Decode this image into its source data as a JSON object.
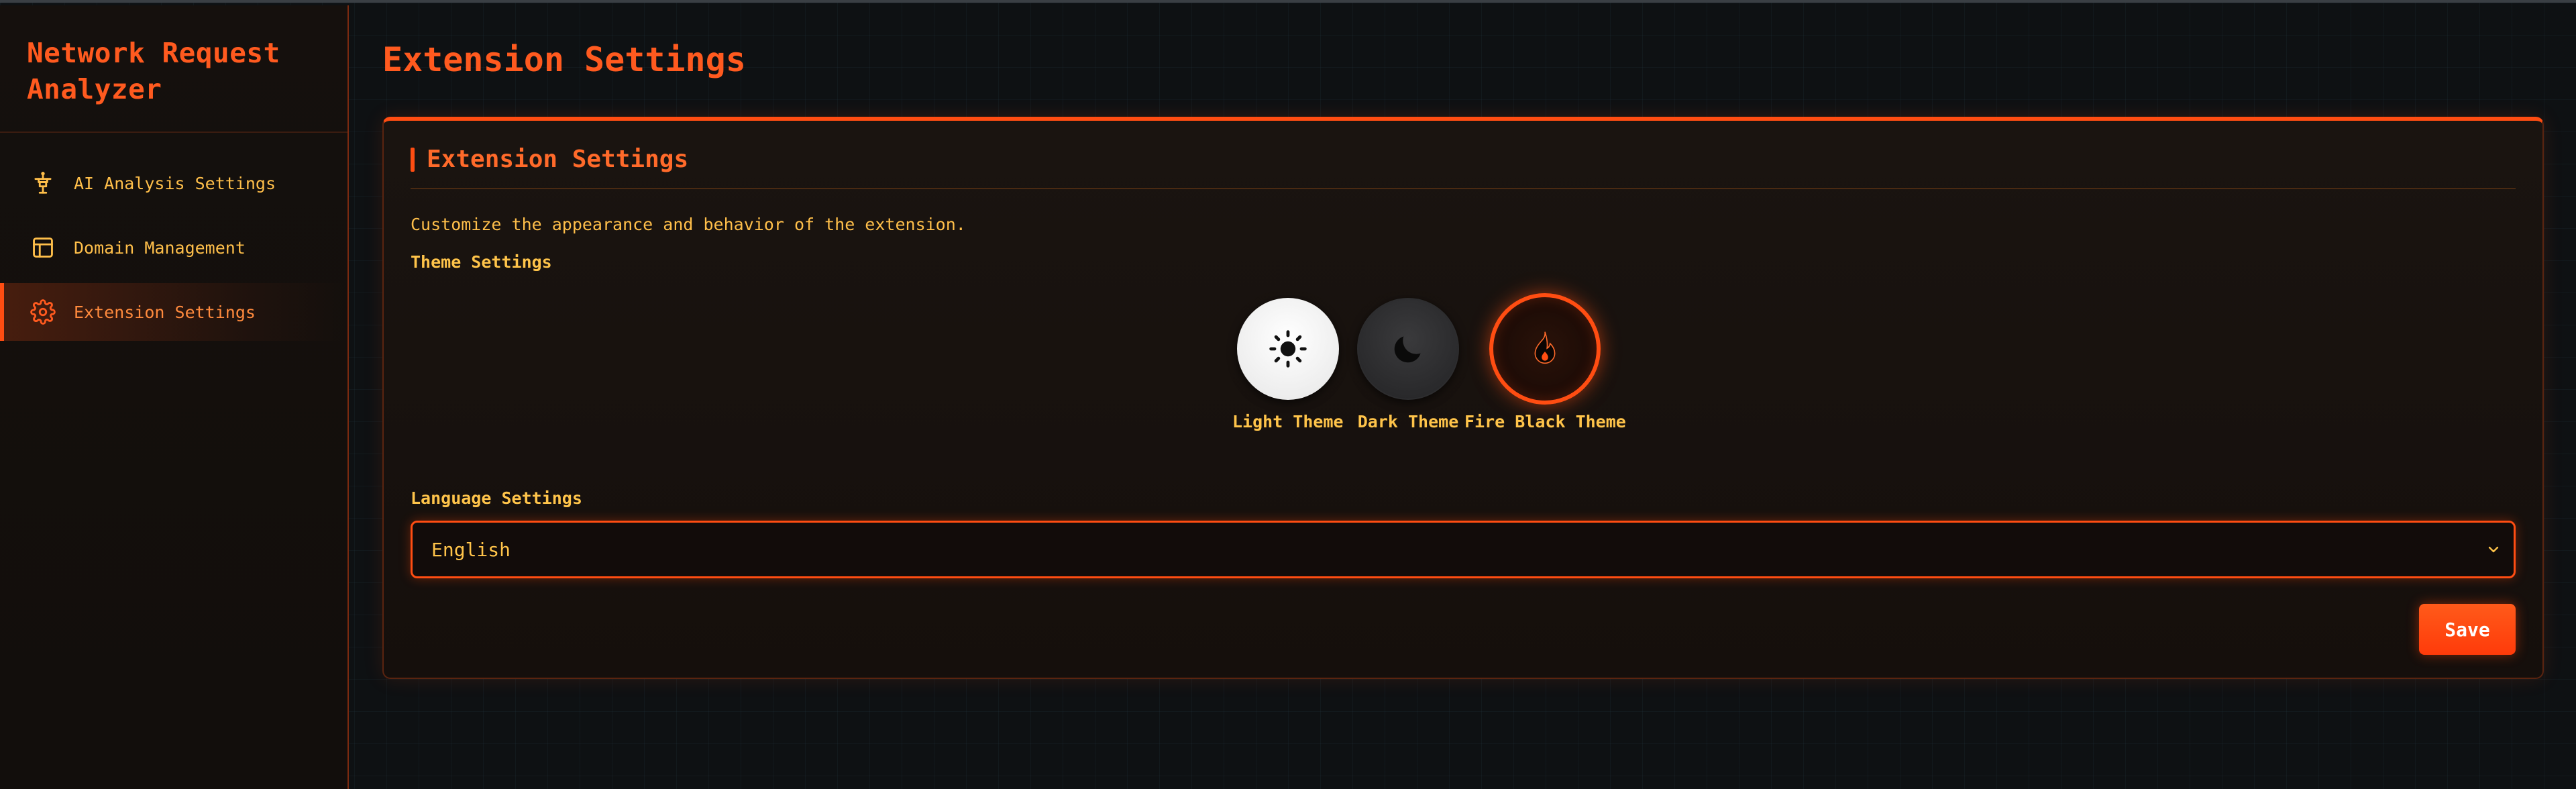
{
  "sidebar": {
    "app_title": "Network Request Analyzer",
    "items": [
      {
        "label": "AI Analysis Settings",
        "icon": "ai-robot-icon",
        "active": false
      },
      {
        "label": "Domain Management",
        "icon": "layout-panel-icon",
        "active": false
      },
      {
        "label": "Extension Settings",
        "icon": "gear-icon",
        "active": true
      }
    ]
  },
  "main": {
    "page_title": "Extension Settings",
    "card": {
      "title": "Extension Settings",
      "description": "Customize the appearance and behavior of the extension.",
      "theme_section_label": "Theme Settings",
      "themes": [
        {
          "label": "Light Theme",
          "icon": "sun-icon",
          "selected": false
        },
        {
          "label": "Dark Theme",
          "icon": "moon-icon",
          "selected": false
        },
        {
          "label": "Fire Black Theme",
          "icon": "flame-icon",
          "selected": true
        }
      ],
      "language_section_label": "Language Settings",
      "language_select": {
        "value": "English"
      },
      "save_label": "Save"
    }
  },
  "colors": {
    "accent": "#ff4d12",
    "accent_text": "#ff5a1f",
    "label_text": "#ffc44a",
    "background": "#0e1113"
  }
}
